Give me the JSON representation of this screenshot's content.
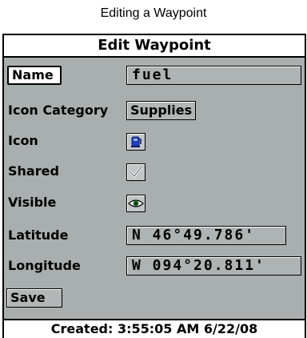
{
  "caption": "Editing a Waypoint",
  "dialog": {
    "title": "Edit Waypoint",
    "name": {
      "label": "Name",
      "value": "fuel"
    },
    "icon_category": {
      "label": "Icon Category",
      "value": "Supplies"
    },
    "icon": {
      "label": "Icon",
      "icon_name": "fuel-pump-icon"
    },
    "shared": {
      "label": "Shared",
      "checked": true,
      "icon_name": "checkmark-icon"
    },
    "visible": {
      "label": "Visible",
      "icon_name": "eye-icon"
    },
    "latitude": {
      "label": "Latitude",
      "value": "N 46°49.786'"
    },
    "longitude": {
      "label": "Longitude",
      "value": "W 094°20.811'"
    },
    "save_label": "Save",
    "created": "Created: 3:55:05 AM 6/22/08"
  },
  "colors": {
    "dialog_bg": "#a9aeaf",
    "header_bg": "#ffffff",
    "icon_blue": "#1f3fbf"
  }
}
